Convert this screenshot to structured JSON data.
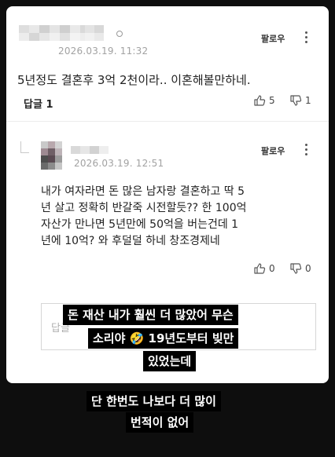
{
  "comment1": {
    "date": "2026.03.19. 11:32",
    "follow_label": "팔로우",
    "text": "5년정도 결혼후 3억 2천이라.. 이혼해볼만하네.",
    "replies_label": "답글 1",
    "likes": "5",
    "dislikes": "1"
  },
  "comment2": {
    "date": "2026.03.19. 12:51",
    "follow_label": "팔로우",
    "lines": [
      "내가 여자라면 돈 많은 남자랑 결혼하고 딱 5",
      "년 살고 정확히 반갈죽 시전할듯?? 한 100억",
      "자산가 만나면 5년만에 50억을 버는건데 1",
      "년에 10억? 와 후덜덜 하네 창조경제네"
    ],
    "likes": "0",
    "dislikes": "0"
  },
  "reply_input": {
    "placeholder": "답글"
  },
  "caption1": {
    "lines": [
      "돈 재산 내가 훨씬 더 많았어 무슨",
      "소리야 🤣 19년도부터 빚만",
      "있었는데"
    ]
  },
  "caption2": {
    "lines": [
      "단 한번도 나보다 더 많이",
      "번적이 없어"
    ]
  },
  "colors": {
    "background": "#0e0e0e",
    "card": "#ffffff",
    "caption_bg": "#000000",
    "caption_text": "#ffffff"
  }
}
